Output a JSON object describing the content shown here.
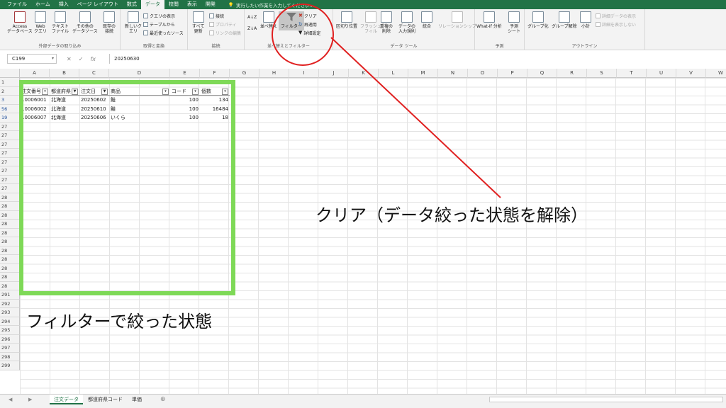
{
  "tabs": [
    "ファイル",
    "ホーム",
    "挿入",
    "ページ レイアウト",
    "数式",
    "データ",
    "校閲",
    "表示",
    "開発"
  ],
  "active_tab_index": 5,
  "tellme": "実行したい作業を入力してください...",
  "ribbon": {
    "groups": {
      "external": "外部データの取り込み",
      "transform": "取得と変換",
      "connections": "接続",
      "sortfilter": "並べ替えとフィルター",
      "datatools": "データ ツール",
      "forecast": "予測",
      "outline": "アウトライン"
    },
    "access": "Access\nデータベース",
    "web": "Web\nクエリ",
    "text": "テキスト\nファイル",
    "other": "その他の\nデータソース",
    "existing": "既存の\n接続",
    "newquery": "新しいク\nエリ",
    "show_queries": "クエリの表示",
    "from_table": "テーブルから",
    "recent": "最近使ったソース",
    "refresh": "すべて\n更新",
    "connections": "接続",
    "properties": "プロパティ",
    "edit_links": "リンクの編集",
    "sort_az": "A↓Z",
    "sort_za": "Z↓A",
    "sort": "並べ替え",
    "filter": "フィルター",
    "clear": "クリア",
    "reapply": "再適用",
    "advanced": "詳細設定",
    "text_to_columns": "区切り位置",
    "flash_fill": "フラッシュ\nフィル",
    "remove_dup": "重複の\n削除",
    "validation": "データの\n入力規則",
    "consolidate": "統合",
    "relationships": "リレーションシップ",
    "whatif": "What-If 分析",
    "forecast_sheet": "予測\nシート",
    "group": "グループ化",
    "ungroup": "グループ解除",
    "subtotal": "小計",
    "show_detail": "詳細データの表示",
    "hide_detail": "詳細を表示しない"
  },
  "formula": {
    "name_box": "C199",
    "value": "20250630"
  },
  "columns": [
    "A",
    "B",
    "C",
    "D",
    "E",
    "F",
    "G",
    "H",
    "I",
    "J",
    "K",
    "L",
    "M",
    "N",
    "O",
    "P",
    "Q",
    "R",
    "S",
    "T",
    "U",
    "V",
    "W"
  ],
  "row_numbers": [
    "1",
    "2",
    "3",
    "56",
    "19",
    "27",
    "27",
    "27",
    "27",
    "27",
    "27",
    "27",
    "27",
    "28",
    "28",
    "28",
    "28",
    "28",
    "28",
    "28",
    "28",
    "28",
    "28",
    "28",
    "291",
    "292",
    "293",
    "294",
    "295",
    "296",
    "297",
    "298",
    "299"
  ],
  "filtered_rows": [
    3,
    4,
    5
  ],
  "table": {
    "headers": [
      "注文番号",
      "都道府県",
      "注文日",
      "商品",
      "コード",
      "個数"
    ],
    "rows": [
      [
        "10006001",
        "北海道",
        "20250602",
        "鮭",
        "100",
        "134"
      ],
      [
        "10006002",
        "北海道",
        "20250610",
        "鮭",
        "100",
        "16484"
      ],
      [
        "10006007",
        "北海道",
        "20250606",
        "いくら",
        "100",
        "18"
      ]
    ]
  },
  "sheets": [
    "注文データ",
    "都道府県コード",
    "単価"
  ],
  "active_sheet_index": 0,
  "annotations": {
    "clear_label": "クリア（データ絞った状態を解除）",
    "filtered_label": "フィルターで絞った状態"
  },
  "colors": {
    "excel_green": "#217346",
    "highlight_green": "#7ed957",
    "annotation_red": "#e02020"
  }
}
